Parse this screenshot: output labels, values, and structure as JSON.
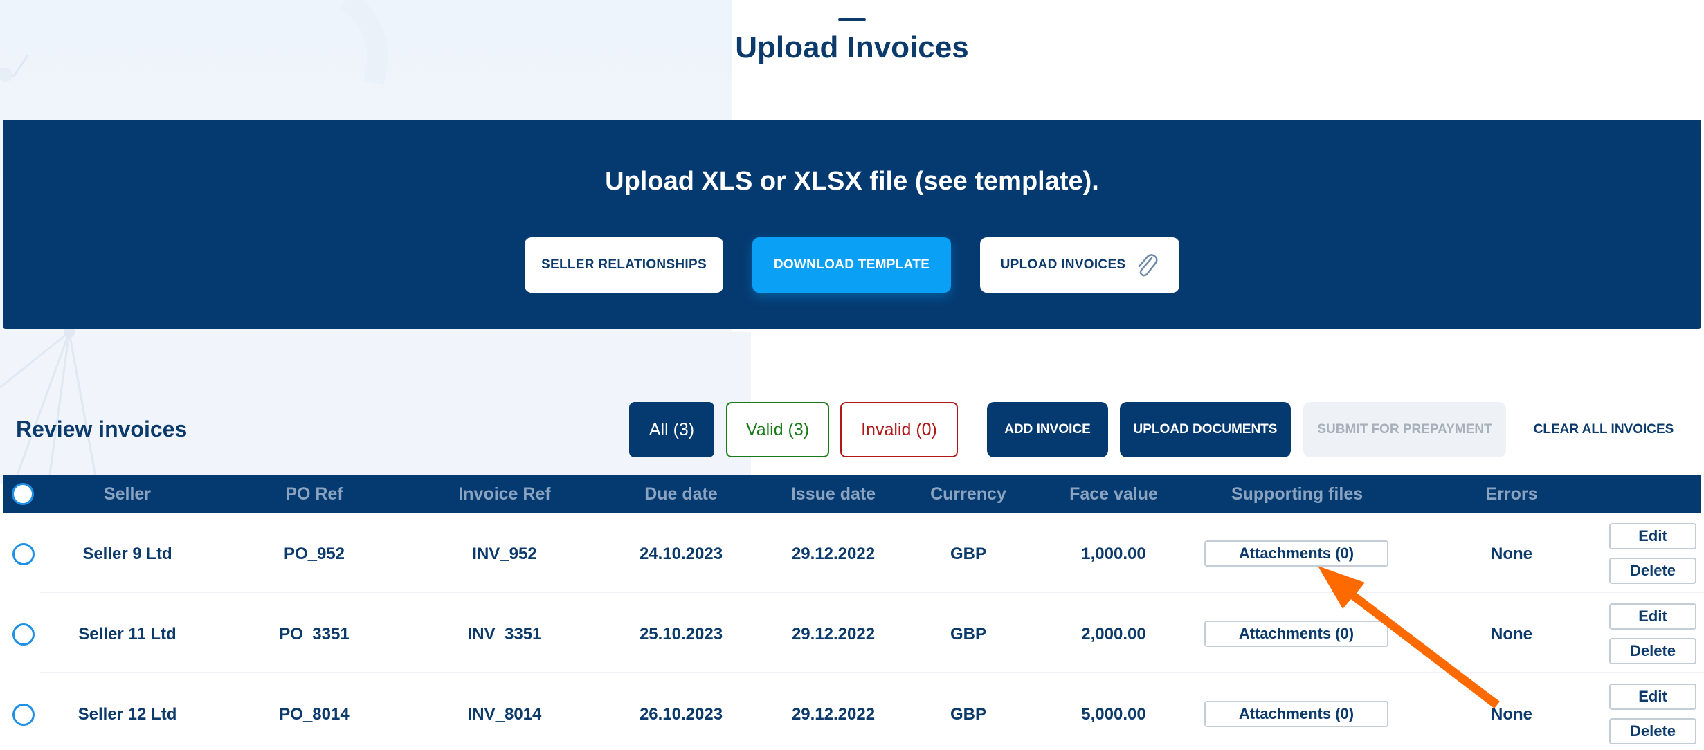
{
  "page": {
    "title": "Upload Invoices"
  },
  "banner": {
    "text": "Upload XLS or XLSX file (see template).",
    "buttons": {
      "seller_relationships": "SELLER RELATIONSHIPS",
      "download_template": "DOWNLOAD TEMPLATE",
      "upload_invoices": "UPLOAD INVOICES"
    }
  },
  "review": {
    "title": "Review invoices",
    "filters": {
      "all": "All (3)",
      "valid": "Valid (3)",
      "invalid": "Invalid (0)"
    },
    "actions": {
      "add_invoice": "ADD INVOICE",
      "upload_documents": "UPLOAD DOCUMENTS",
      "submit_for_prepayment": "SUBMIT FOR PREPAYMENT",
      "clear_all_invoices": "CLEAR ALL INVOICES"
    }
  },
  "table": {
    "columns": [
      "Seller",
      "PO Ref",
      "Invoice Ref",
      "Due date",
      "Issue date",
      "Currency",
      "Face value",
      "Supporting files",
      "Errors"
    ],
    "rows": [
      {
        "seller": "Seller 9 Ltd",
        "po_ref": "PO_952",
        "invoice_ref": "INV_952",
        "due_date": "24.10.2023",
        "issue_date": "29.12.2022",
        "currency": "GBP",
        "face_value": "1,000.00",
        "supporting_files": "Attachments (0)",
        "errors": "None"
      },
      {
        "seller": "Seller 11 Ltd",
        "po_ref": "PO_3351",
        "invoice_ref": "INV_3351",
        "due_date": "25.10.2023",
        "issue_date": "29.12.2022",
        "currency": "GBP",
        "face_value": "2,000.00",
        "supporting_files": "Attachments (0)",
        "errors": "None"
      },
      {
        "seller": "Seller 12 Ltd",
        "po_ref": "PO_8014",
        "invoice_ref": "INV_8014",
        "due_date": "26.10.2023",
        "issue_date": "29.12.2022",
        "currency": "GBP",
        "face_value": "5,000.00",
        "supporting_files": "Attachments (0)",
        "errors": "None"
      }
    ],
    "row_actions": {
      "edit": "Edit",
      "delete": "Delete"
    }
  },
  "colors": {
    "navy": "#053a70",
    "accent_blue": "#0aa0f5",
    "valid_green": "#1a7a1a",
    "invalid_red": "#b01818",
    "annotation_arrow": "#ff6a00"
  },
  "icons": {
    "upload": "paperclip-icon",
    "annotation": "arrow-annotation"
  }
}
